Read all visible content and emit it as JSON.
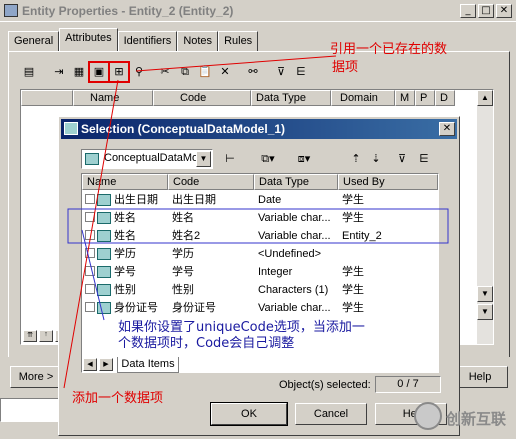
{
  "main_window": {
    "title": "Entity Properties - Entity_2 (Entity_2)",
    "tabs": [
      "General",
      "Attributes",
      "Identifiers",
      "Notes",
      "Rules"
    ],
    "columns": [
      "Name",
      "Code",
      "Data Type",
      "Domain",
      "M",
      "P",
      "D"
    ],
    "more_button": "More >",
    "help_button": "Help"
  },
  "dialog": {
    "title": "Selection (ConceptualDataModel_1)",
    "model_select": "ConceptualDataMo",
    "columns": [
      "Name",
      "Code",
      "Data Type",
      "Used By"
    ],
    "rows": [
      {
        "name": "出生日期",
        "code": "出生日期",
        "type": "Date",
        "used_by": "学生"
      },
      {
        "name": "姓名",
        "code": "姓名",
        "type": "Variable char...",
        "used_by": "学生"
      },
      {
        "name": "姓名",
        "code": "姓名2",
        "type": "Variable char...",
        "used_by": "Entity_2"
      },
      {
        "name": "学历",
        "code": "学历",
        "type": "<Undefined>",
        "used_by": ""
      },
      {
        "name": "学号",
        "code": "学号",
        "type": "Integer",
        "used_by": "学生"
      },
      {
        "name": "性别",
        "code": "性别",
        "type": "Characters (1)",
        "used_by": "学生"
      },
      {
        "name": "身份证号",
        "code": "身份证号",
        "type": "Variable char...",
        "used_by": "学生"
      }
    ],
    "bottom_tab": "Data Items",
    "selected_label": "Object(s) selected:",
    "selected_value": "0 / 7",
    "ok_button": "OK",
    "cancel_button": "Cancel",
    "help_button": "Hel"
  },
  "annotations": {
    "reuse_existing": "引用一个已存在的数",
    "reuse_existing_line2": "据项",
    "unique_code_line1": "如果你设置了uniqueCode选项，当添加一",
    "unique_code_line2": "个数据项时，Code会自己调整",
    "add_item": "添加一个数据项"
  },
  "watermark": "创新互联",
  "colors": {
    "annotation_red": "#e00000",
    "annotation_blue": "#1a1aa0",
    "dialog_title": "#0a246a"
  }
}
